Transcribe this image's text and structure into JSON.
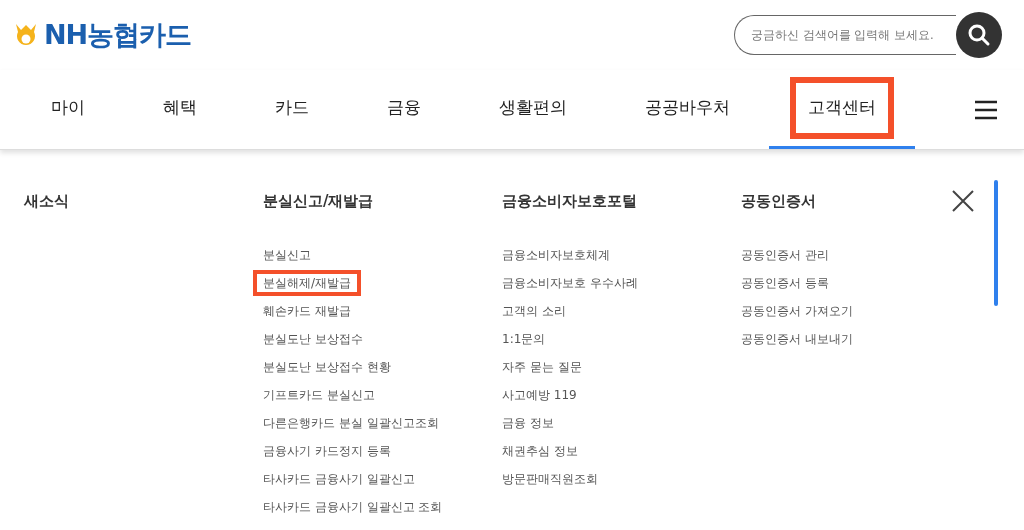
{
  "logo": {
    "text": "NH농협카드"
  },
  "search": {
    "placeholder": "궁금하신 검색어를 입력해 보세요."
  },
  "nav": [
    {
      "label": "마이",
      "selected": false,
      "highlighted": false
    },
    {
      "label": "혜택",
      "selected": false,
      "highlighted": false
    },
    {
      "label": "카드",
      "selected": false,
      "highlighted": false
    },
    {
      "label": "금융",
      "selected": false,
      "highlighted": false
    },
    {
      "label": "생활편의",
      "selected": false,
      "highlighted": false
    },
    {
      "label": "공공바우처",
      "selected": false,
      "highlighted": false
    },
    {
      "label": "고객센터",
      "selected": true,
      "highlighted": true
    }
  ],
  "menu": {
    "columns": [
      {
        "title": "새소식"
      },
      {
        "title": "분실신고/재발급",
        "items": [
          {
            "label": "분실신고",
            "highlighted": false
          },
          {
            "label": "분실해제/재발급",
            "highlighted": true
          },
          {
            "label": "훼손카드 재발급",
            "highlighted": false
          },
          {
            "label": "분실도난 보상접수",
            "highlighted": false
          },
          {
            "label": "분실도난 보상접수 현황",
            "highlighted": false
          },
          {
            "label": "기프트카드 분실신고",
            "highlighted": false
          },
          {
            "label": "다른은행카드 분실 일괄신고조회",
            "highlighted": false
          },
          {
            "label": "금융사기 카드정지 등록",
            "highlighted": false
          },
          {
            "label": "타사카드 금융사기 일괄신고",
            "highlighted": false
          },
          {
            "label": "타사카드 금융사기 일괄신고 조회",
            "highlighted": false
          }
        ]
      },
      {
        "title": "금융소비자보호포털",
        "items": [
          {
            "label": "금융소비자보호체계",
            "highlighted": false
          },
          {
            "label": "금융소비자보호 우수사례",
            "highlighted": false
          },
          {
            "label": "고객의 소리",
            "highlighted": false
          },
          {
            "label": "1:1문의",
            "highlighted": false
          },
          {
            "label": "자주 묻는 질문",
            "highlighted": false
          },
          {
            "label": "사고예방 119",
            "highlighted": false
          },
          {
            "label": "금융 정보",
            "highlighted": false
          },
          {
            "label": "채권추심 정보",
            "highlighted": false
          },
          {
            "label": "방문판매직원조회",
            "highlighted": false
          }
        ]
      },
      {
        "title": "공동인증서",
        "items": [
          {
            "label": "공동인증서 관리",
            "highlighted": false
          },
          {
            "label": "공동인증서 등록",
            "highlighted": false
          },
          {
            "label": "공동인증서 가져오기",
            "highlighted": false
          },
          {
            "label": "공동인증서 내보내기",
            "highlighted": false
          }
        ]
      }
    ]
  }
}
